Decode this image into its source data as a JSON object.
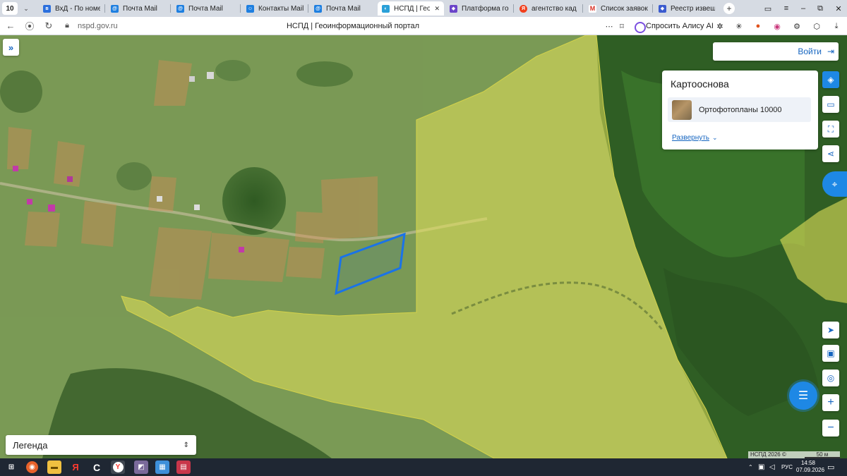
{
  "browser": {
    "tab_count": "10",
    "tabs": [
      {
        "title": "ВхД - По номеру",
        "favicon": "vk-icon",
        "color": "#2b6fdd",
        "active": false
      },
      {
        "title": "Почта Mail",
        "favicon": "mail-icon",
        "color": "#1e7fe0",
        "active": false
      },
      {
        "title": "Почта Mail",
        "favicon": "mail-icon",
        "color": "#1e7fe0",
        "active": false
      },
      {
        "title": "Контакты Mail",
        "favicon": "contacts-icon",
        "color": "#1e7fe0",
        "active": false
      },
      {
        "title": "Почта Mail",
        "favicon": "mail-icon",
        "color": "#1e7fe0",
        "active": false
      },
      {
        "title": "НСПД | Геоинф",
        "favicon": "nspd-icon",
        "color": "#2aa0d8",
        "active": true
      },
      {
        "title": "Платформа госуд",
        "favicon": "gosuslugi-icon",
        "color": "#6b44c9",
        "active": false
      },
      {
        "title": "агентство кад ра",
        "favicon": "yandex-icon",
        "color": "#f23e1b",
        "active": false
      },
      {
        "title": "Список заявок —",
        "favicon": "gmail-icon",
        "color": "#d93025",
        "active": false
      },
      {
        "title": "Реестр извещени",
        "favicon": "registry-icon",
        "color": "#3b5bcf",
        "active": false
      }
    ],
    "address": {
      "url": "nspd.gov.ru",
      "page_title": "НСПД | Геоинформационный портал",
      "alice_label": "Спросить Алису AI"
    }
  },
  "map": {
    "login_label": "Войти",
    "basemap_panel": {
      "title": "Картооснова",
      "selected_layer": "Ортофотопланы 10000",
      "expand_label": "Развернуть"
    },
    "legend_label": "Легенда",
    "attribution": "НСПД 2026 ©",
    "scale_label": "50 м",
    "colors": {
      "zone_fill": "#e3e15a",
      "parcel_fill": "#d98a55",
      "selected_outline": "#1a73e8",
      "accent": "#1e88e5"
    },
    "tools": [
      "layers-icon",
      "ruler-icon",
      "scan-area-icon",
      "share-icon",
      "search-panel-icon",
      "locate-icon",
      "panel-icon",
      "pin-icon",
      "zoom-in-icon",
      "zoom-out-icon"
    ]
  },
  "taskbar": {
    "lang": "РУС",
    "time": "14:58",
    "date": "07.09.2026"
  }
}
